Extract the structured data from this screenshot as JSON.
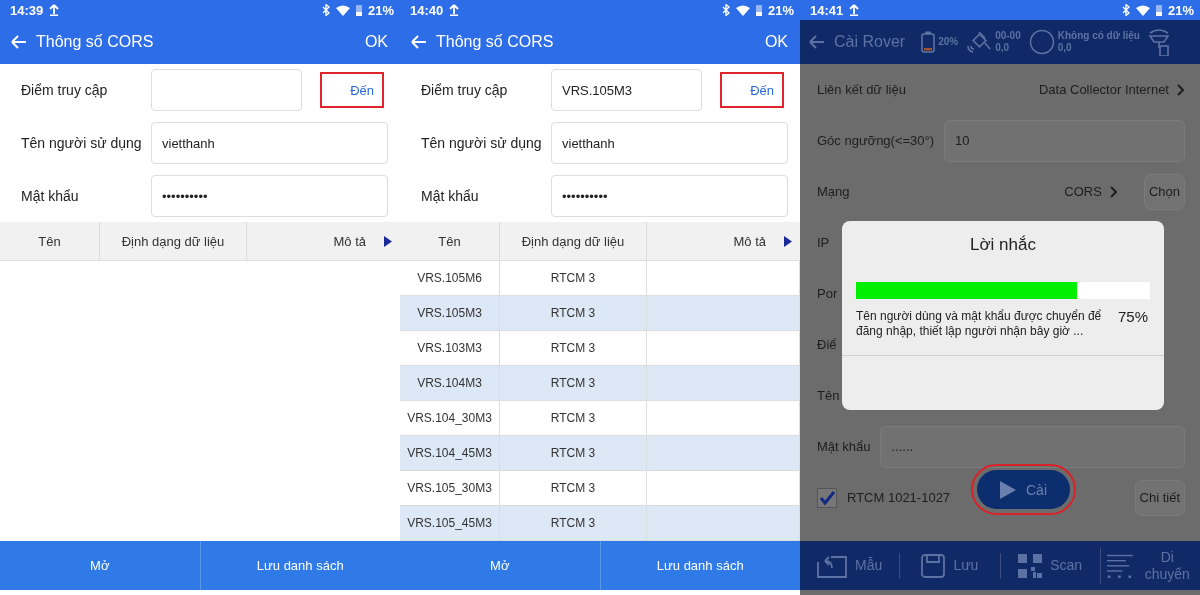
{
  "screens": [
    {
      "kind": "cors",
      "status_bar": {
        "time": "14:39",
        "battery": "21%"
      },
      "header": {
        "title": "Thông số CORS",
        "action": "OK"
      },
      "form": [
        {
          "label": "Điểm truy cập",
          "button": {
            "label": "Đến",
            "highlighted": true
          }
        },
        {
          "label": "Tên người sử dụng",
          "value": "vietthanh"
        },
        {
          "label": "Mật khẩu",
          "value": "••••••••••"
        }
      ],
      "table": {
        "columns": [
          "Tên",
          "Định dạng dữ liệu",
          "Mô tả"
        ]
      },
      "bottom_buttons": [
        "Mở",
        "Lưu danh sách"
      ]
    },
    {
      "kind": "cors",
      "status_bar": {
        "time": "14:40",
        "battery": "21%"
      },
      "header": {
        "title": "Thông số CORS",
        "action": "OK"
      },
      "form": [
        {
          "label": "Điểm truy cập",
          "value": "VRS.105M3",
          "button": {
            "label": "Đến",
            "highlighted": true
          }
        },
        {
          "label": "Tên người sử dụng",
          "value": "vietthanh"
        },
        {
          "label": "Mật khẩu",
          "value": "••••••••••"
        }
      ],
      "table": {
        "columns": [
          "Tên",
          "Định dạng dữ liệu",
          "Mô tả"
        ],
        "rows": [
          {
            "cells": [
              "VRS.105M6",
              "RTCM 3"
            ]
          },
          {
            "cells": [
              "VRS.105M3",
              "RTCM 3"
            ]
          },
          {
            "cells": [
              "VRS.103M3",
              "RTCM 3"
            ]
          },
          {
            "cells": [
              "VRS.104M3",
              "RTCM 3"
            ]
          },
          {
            "cells": [
              "VRS.104_30M3",
              "RTCM 3"
            ]
          },
          {
            "cells": [
              "VRS.104_45M3",
              "RTCM 3"
            ]
          },
          {
            "cells": [
              "VRS.105_30M3",
              "RTCM 3"
            ]
          },
          {
            "cells": [
              "VRS.105_45M3",
              "RTCM 3"
            ]
          }
        ]
      },
      "bottom_buttons": [
        "Mở",
        "Lưu danh sách"
      ]
    },
    {
      "kind": "rover",
      "status_bar": {
        "time": "14:41",
        "battery": "21%"
      },
      "toolbar": {
        "title": "Cài Rover",
        "indicators": [
          {
            "kind": "battery",
            "lines": [
              "20%"
            ]
          },
          {
            "kind": "satellite",
            "lines": [
              "00-00",
              "0,0"
            ]
          },
          {
            "kind": "circle",
            "lines": [
              "Không có dữ liệu",
              "0,0"
            ]
          },
          {
            "kind": "antenna"
          }
        ]
      },
      "rows": [
        {
          "kind": "link",
          "label": "Liên kết dữ liệu",
          "value": "Data Collector Internet"
        },
        {
          "kind": "input",
          "label": "Góc ngưỡng(<=30°)",
          "value": "10"
        },
        {
          "kind": "choice",
          "label": "Mạng",
          "value": "CORS",
          "button": "Chọn"
        },
        {
          "kind": "covered",
          "label": "IP"
        },
        {
          "kind": "covered",
          "label": "Por"
        },
        {
          "kind": "covered",
          "label": "Điể"
        },
        {
          "kind": "covered",
          "label": "Tên"
        },
        {
          "kind": "input",
          "label": "Mật khẩu",
          "value": "......"
        },
        {
          "kind": "check",
          "label": "RTCM 1021-1027",
          "checked": true,
          "button": "Chi tiết"
        }
      ],
      "fab": {
        "label": "Cài",
        "highlighted": true
      },
      "dialog": {
        "title": "Lời nhắc",
        "progress": {
          "level": 0.75
        },
        "message": "Tên người dùng và mật khẩu được chuyển để đăng nhập, thiết lập người nhận bây giờ ...",
        "percent": "75%"
      },
      "bottom_tools": [
        {
          "kind": "template",
          "label": "Mẫu"
        },
        {
          "kind": "save",
          "label": "Lưu"
        },
        {
          "kind": "scan",
          "label": "Scan"
        },
        {
          "kind": "move",
          "label": "Di chuyển"
        }
      ]
    }
  ]
}
